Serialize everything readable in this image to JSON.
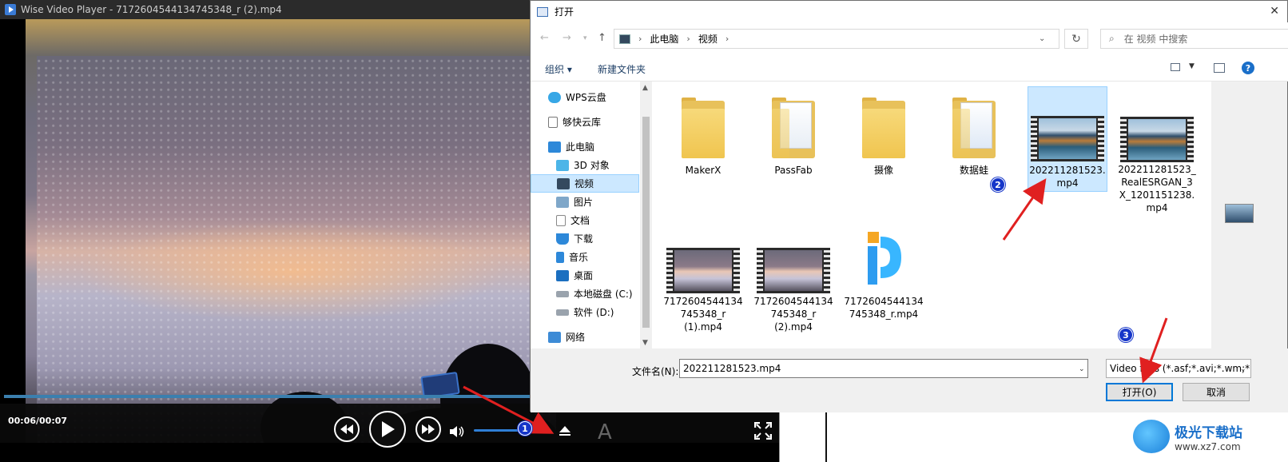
{
  "player": {
    "title": "Wise Video Player - 7172604544134745348_r (2).mp4",
    "time": "00:06/00:07",
    "progress": 0.86,
    "volume": 0.55,
    "subtitle_glyph": "A"
  },
  "dialog": {
    "title": "打开",
    "breadcrumb": [
      "此电脑",
      "视频"
    ],
    "search_placeholder": "在 视频 中搜索",
    "toolbar": {
      "organize": "组织",
      "new_folder": "新建文件夹"
    },
    "nav": [
      {
        "label": "WPS云盘",
        "icon": "cloud-icon"
      },
      {
        "label": "够快云库",
        "icon": "document-icon"
      },
      {
        "label": "此电脑",
        "icon": "computer-icon"
      },
      {
        "label": "3D 对象",
        "icon": "cube-icon"
      },
      {
        "label": "视频",
        "icon": "video-folder-icon",
        "selected": true
      },
      {
        "label": "图片",
        "icon": "image-icon"
      },
      {
        "label": "文档",
        "icon": "document-icon"
      },
      {
        "label": "下载",
        "icon": "download-icon"
      },
      {
        "label": "音乐",
        "icon": "music-icon"
      },
      {
        "label": "桌面",
        "icon": "desktop-icon"
      },
      {
        "label": "本地磁盘 (C:)",
        "icon": "drive-icon"
      },
      {
        "label": "软件 (D:)",
        "icon": "drive-icon"
      },
      {
        "label": "网络",
        "icon": "network-icon"
      }
    ],
    "files": [
      {
        "name": "MakerX",
        "kind": "folder"
      },
      {
        "name": "PassFab",
        "kind": "folder-docs"
      },
      {
        "name": "摄像",
        "kind": "folder"
      },
      {
        "name": "数据蛙",
        "kind": "folder-docs"
      },
      {
        "name": "202211281523.\nmp4",
        "kind": "video-lake",
        "selected": true
      },
      {
        "name": "202211281523_\nRealESRGAN_3\nX_1201151238.\nmp4",
        "kind": "video-lake"
      },
      {
        "name": "7172604544134\n745348_r\n(1).mp4",
        "kind": "video-fire"
      },
      {
        "name": "7172604544134\n745348_r\n(2).mp4",
        "kind": "video-fire"
      },
      {
        "name": "7172604544134\n745348_r.mp4",
        "kind": "app"
      }
    ],
    "filename_label": "文件名(N):",
    "filename_value": "202211281523.mp4",
    "filetype_value": "Video files (*.asf;*.avi;*.wm;*.",
    "open_button": "打开(O)",
    "cancel_button": "取消"
  },
  "annotations": [
    "1",
    "2",
    "3"
  ],
  "colors": {
    "accent": "#0078d7",
    "selection": "#cce8ff",
    "annotation": "#1636c9",
    "arrow": "#e02020"
  },
  "watermark": {
    "title": "极光下载站",
    "url": "www.xz7.com"
  }
}
